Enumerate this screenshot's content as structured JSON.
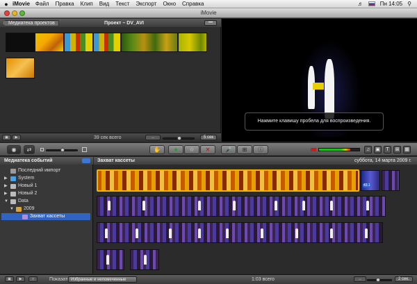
{
  "menubar": {
    "apple": "",
    "app": "iMovie",
    "items": [
      "Файл",
      "Правка",
      "Клип",
      "Вид",
      "Текст",
      "Экспорт",
      "Окно",
      "Справка"
    ],
    "clock": "Пн 14:05"
  },
  "window": {
    "title": "iMovie"
  },
  "project": {
    "back_label": "Медиатека проектов",
    "title": "Проект – DV_AVI",
    "more": "•••",
    "total": "39 сек всего",
    "duration": "5 сек"
  },
  "viewer": {
    "hint": "Нажмите клавишу пробела для воспроизведения."
  },
  "event_library": {
    "header": "Медиатека событий",
    "items": [
      {
        "label": "Последний импорт"
      },
      {
        "label": "System"
      },
      {
        "label": "Новый 1"
      },
      {
        "label": "Новый 2"
      },
      {
        "label": "Data"
      },
      {
        "label": "2009"
      },
      {
        "label": "Захват кассеты"
      }
    ]
  },
  "event_browser": {
    "title": "Захват кассеты",
    "date": "суббота, 14 марта 2009 г.",
    "selected_badge": "43.1"
  },
  "bottom": {
    "show_label": "Показать:",
    "show_value": "Избранные и непомеченные",
    "total": "1:03 всего",
    "duration": "2 сек."
  },
  "colors": {
    "selection": "#3164c2",
    "accent": "#f5b300",
    "audio_green": "#1fbf1f"
  }
}
